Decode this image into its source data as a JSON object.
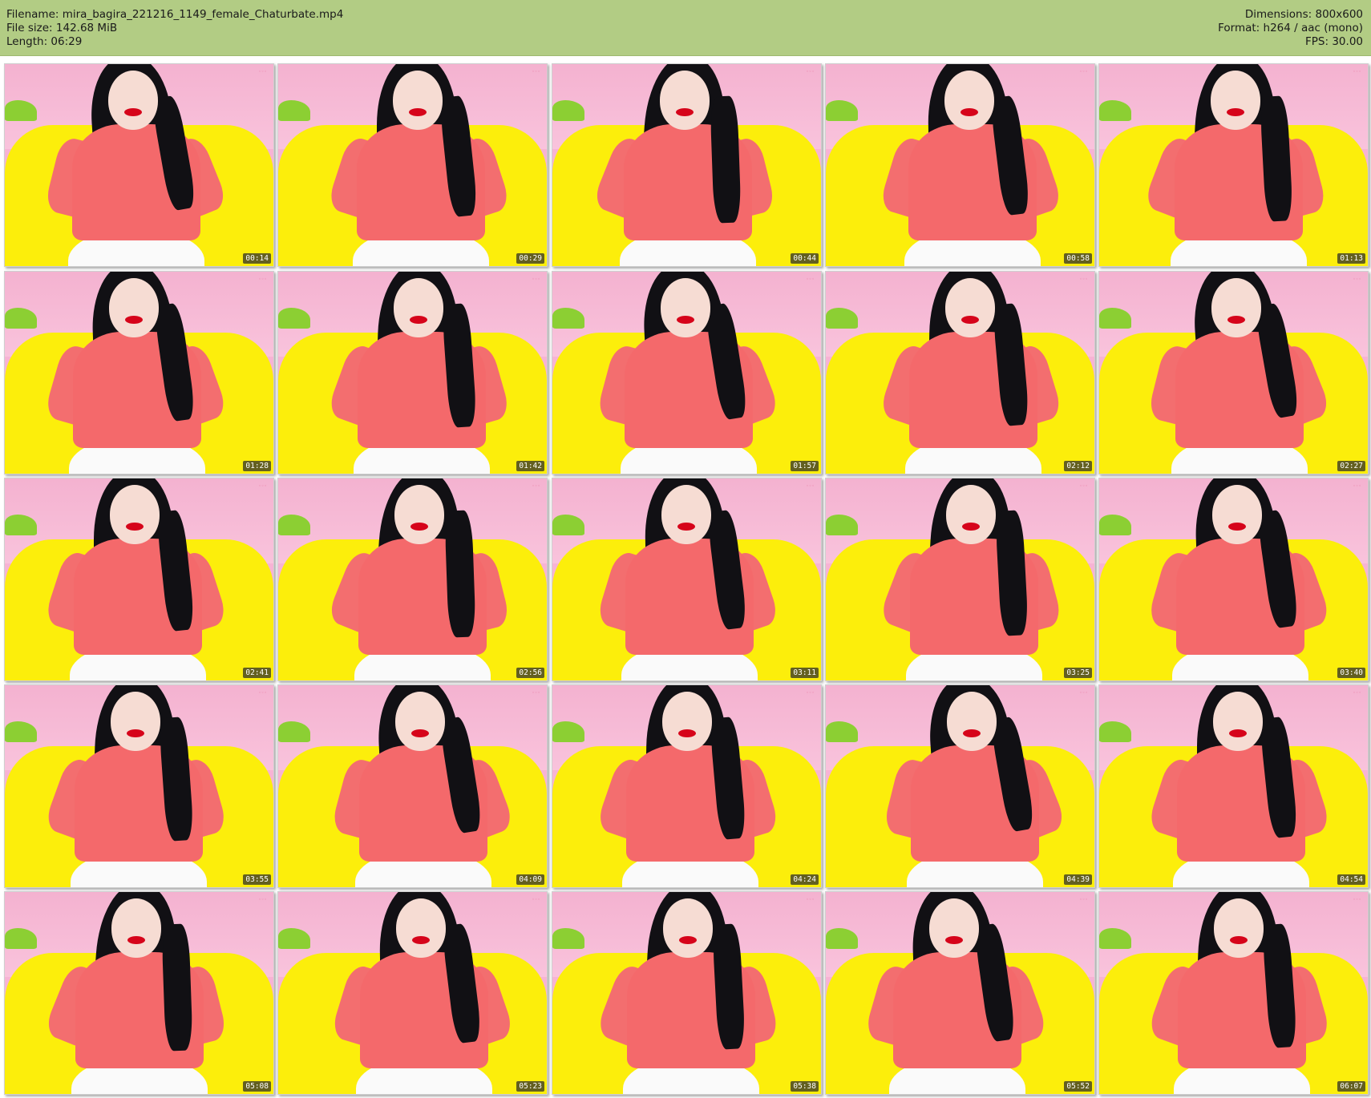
{
  "info": {
    "filename_line": "Filename: mira_bagira_221216_1149_female_Chaturbate.mp4",
    "filesize_line": "File size: 142.68 MiB",
    "length_line": "Length: 06:29",
    "dimensions_line": "Dimensions: 800x600",
    "format_line": "Format: h264 / aac (mono)",
    "fps_line": "FPS: 30.00"
  },
  "colors": {
    "header_bg": "#b2cc84",
    "wall": "#f4b2d0",
    "sofa": "#fcee0b",
    "sweater": "#f4696b",
    "hair": "#111014",
    "lips": "#d6041a"
  },
  "thumbnails": [
    {
      "time": "00:14"
    },
    {
      "time": "00:29"
    },
    {
      "time": "00:44"
    },
    {
      "time": "00:58"
    },
    {
      "time": "01:13"
    },
    {
      "time": "01:28"
    },
    {
      "time": "01:42"
    },
    {
      "time": "01:57"
    },
    {
      "time": "02:12"
    },
    {
      "time": "02:27"
    },
    {
      "time": "02:41"
    },
    {
      "time": "02:56"
    },
    {
      "time": "03:11"
    },
    {
      "time": "03:25"
    },
    {
      "time": "03:40"
    },
    {
      "time": "03:55"
    },
    {
      "time": "04:09"
    },
    {
      "time": "04:24"
    },
    {
      "time": "04:39"
    },
    {
      "time": "04:54"
    },
    {
      "time": "05:08"
    },
    {
      "time": "05:23"
    },
    {
      "time": "05:38"
    },
    {
      "time": "05:52"
    },
    {
      "time": "06:07"
    }
  ]
}
